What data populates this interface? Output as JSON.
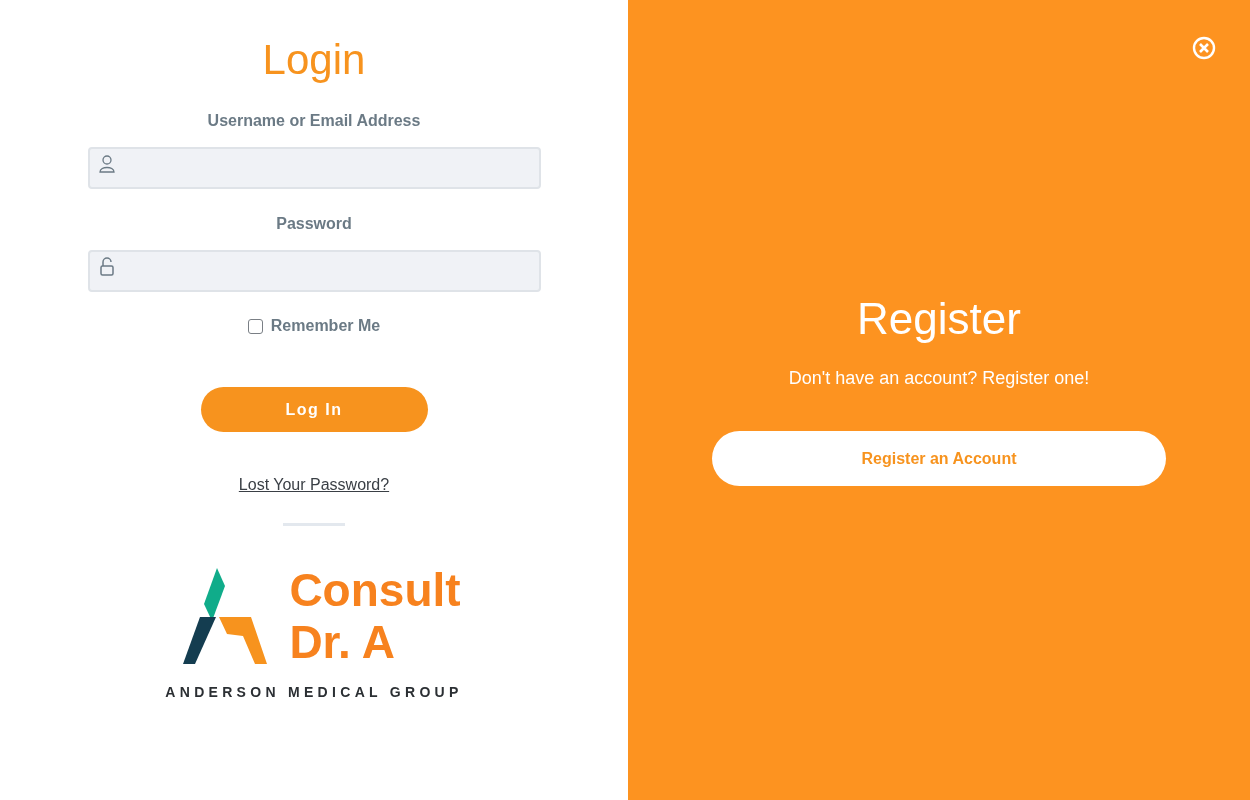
{
  "login": {
    "title": "Login",
    "fields": [
      {
        "kind": "user",
        "label": "Username or Email Address"
      },
      {
        "kind": "password",
        "label": "Password"
      }
    ],
    "remember": {
      "label": "Remember Me",
      "checked": false
    },
    "submit": "Log In",
    "lost_password": "Lost Your Password?",
    "logo": {
      "line1": "Consult",
      "line2": "Dr. A",
      "tagline": "ANDERSON MEDICAL GROUP"
    }
  },
  "register": {
    "title": "Register",
    "text": "Don't have an account? Register one!",
    "button": "Register an Account"
  }
}
